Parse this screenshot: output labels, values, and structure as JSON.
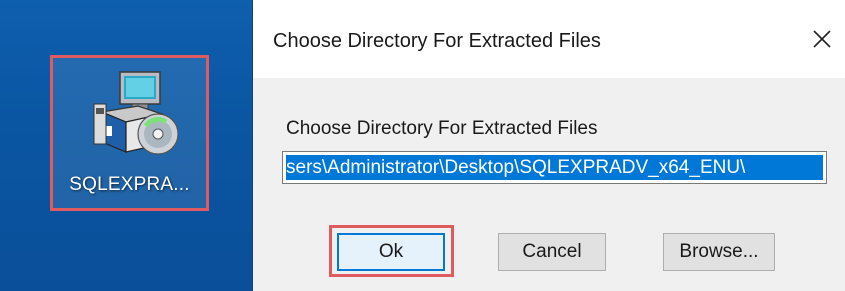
{
  "desktop": {
    "icon_label": "SQLEXPRA..."
  },
  "dialog": {
    "title": "Choose Directory For Extracted Files",
    "prompt": "Choose Directory For Extracted Files",
    "path_value": "sers\\Administrator\\Desktop\\SQLEXPRADV_x64_ENU\\",
    "buttons": {
      "ok": "Ok",
      "cancel": "Cancel",
      "browse": "Browse..."
    },
    "close_glyph": "✕"
  },
  "colors": {
    "desktop_blue": "#0a56a3",
    "highlight_red": "#e05b5f",
    "selection_blue": "#0078d7",
    "dialog_bg": "#f0f0f0"
  },
  "icons": {
    "installer": "installer-icon",
    "close": "close-icon"
  }
}
